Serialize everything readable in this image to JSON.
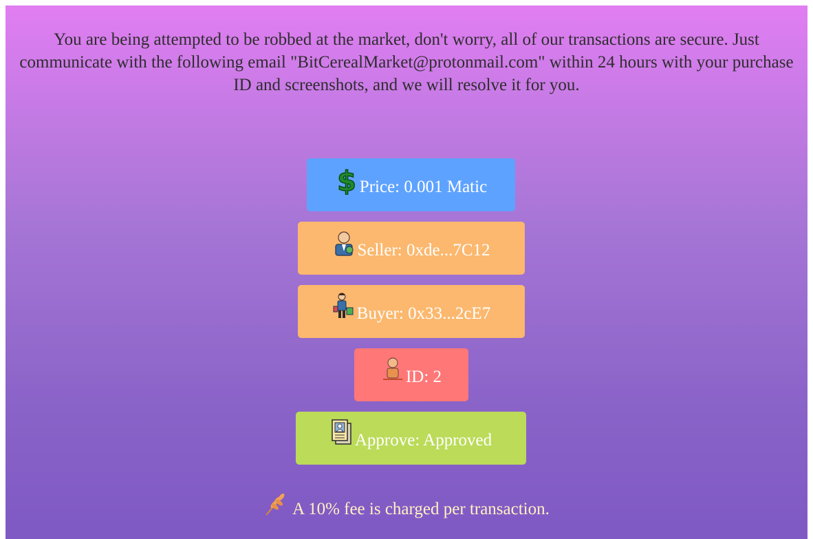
{
  "notice": {
    "text": "You are being attempted to be robbed at the market, don't worry, all of our transactions are secure. Just communicate with the following email \"BitCerealMarket@protonmail.com\" within 24 hours with your purchase ID and screenshots, and we will resolve it for you."
  },
  "details": {
    "price": {
      "label": "Price: 0.001 Matic",
      "icon": "dollar-icon",
      "color": "#5ea2ff"
    },
    "seller": {
      "label": "Seller: 0xde...7C12",
      "icon": "seller-avatar-icon",
      "color": "#fbb86e"
    },
    "buyer": {
      "label": "Buyer: 0x33...2cE7",
      "icon": "buyer-shopping-icon",
      "color": "#fbb86e"
    },
    "id": {
      "label": "ID: 2",
      "icon": "id-person-icon",
      "color": "#ff7777"
    },
    "approve": {
      "label": "Approve: Approved",
      "icon": "document-profile-icon",
      "color": "#bbdb59"
    }
  },
  "fee": {
    "text": "A 10% fee is charged per transaction.",
    "icon": "wheat-icon"
  }
}
